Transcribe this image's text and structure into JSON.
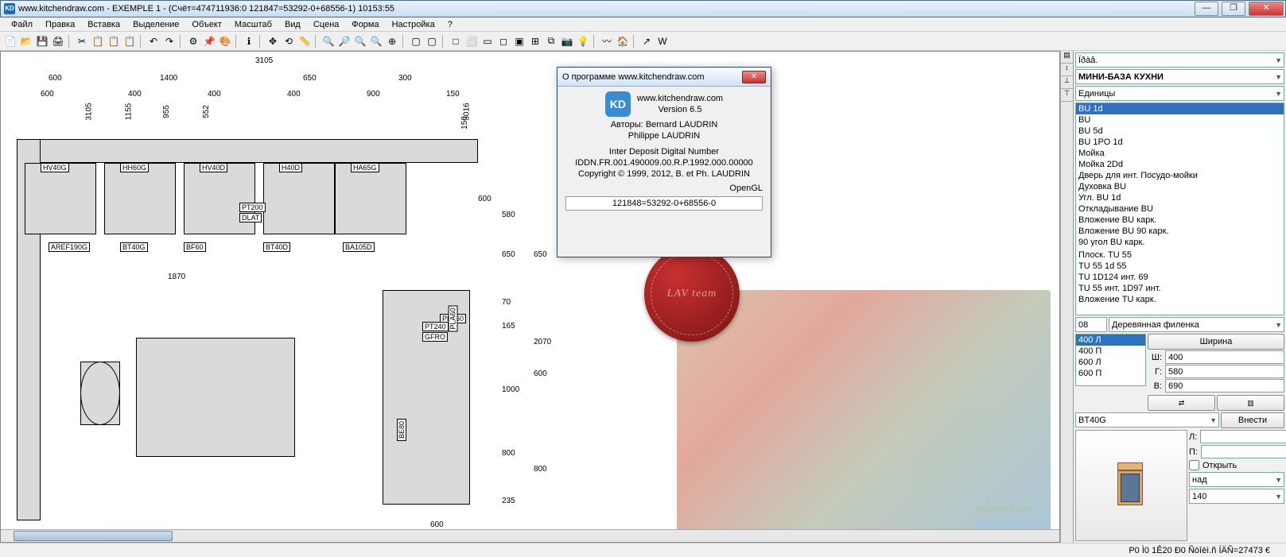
{
  "titlebar": {
    "icon_text": "KD",
    "title": "www.kitchendraw.com - EXEMPLE 1 - (Счёт=474711936:0 121847=53292-0+68556-1) 10153:55"
  },
  "menus": [
    "Файл",
    "Правка",
    "Вставка",
    "Выделение",
    "Объект",
    "Масштаб",
    "Вид",
    "Сцена",
    "Форма",
    "Настройка",
    "?"
  ],
  "toolbar_icons": [
    "📄",
    "📂",
    "💾",
    "🖨",
    "",
    "✂",
    "📋",
    "📋",
    "📋",
    "",
    "↶",
    "↷",
    "",
    "⚙",
    "📌",
    "🎨",
    "",
    "ℹ",
    "",
    "✥",
    "⟲",
    "📏",
    "",
    "🔍",
    "🔎",
    "🔍",
    "🔍",
    "⊕",
    "",
    "▢",
    "▢",
    "",
    "□",
    "⬜",
    "▭",
    "◻",
    "▣",
    "⊞",
    "⧉",
    "📷",
    "💡",
    "",
    "〰",
    "🏠",
    "",
    "↗",
    "W"
  ],
  "right": {
    "idaa": "Ïðàâ.",
    "db": "МИНИ-БАЗА КУХНИ",
    "units": "Единицы",
    "list": [
      "BU  1d",
      "BU",
      "BU 5d",
      "BU 1PO 1d",
      "Мойка",
      "Мойка  2Dd",
      "Дверь для инт. Посудо-мойки",
      "Духовка BU",
      "Угл. BU  1d",
      "Откладывание BU",
      "Вложение BU карк.",
      "Вложение BU 90  карк.",
      "90 угол BU карк.",
      "",
      "Плоск. TU 55",
      "TU 55 1d  55",
      "TU 1D124 инт. 69",
      "TU 55 инт. 1D97 инт.",
      "Вложение TU карк."
    ],
    "list_sel": "BU  1d",
    "front_code": "08",
    "front_label": "Деревянная филенка",
    "sizes": [
      "400 Л",
      "400 П",
      "600 Л",
      "600 П"
    ],
    "size_sel": "400 Л",
    "width_btn": "Ширина",
    "dims": {
      "w_label": "Ш:",
      "w": "400",
      "d_label": "Г:",
      "d": "580",
      "h_label": "В:",
      "h": "690"
    },
    "code": "BT40G",
    "insert_btn": "Внести",
    "side": {
      "l_label": "Л:",
      "r_label": "П:"
    },
    "open_chk": "Открыть",
    "over": "над",
    "depth_last": "140"
  },
  "about": {
    "title": "О программе www.kitchendraw.com",
    "site": "www.kitchendraw.com",
    "ver": "Version 6.5",
    "authors_label": "Авторы:",
    "author1": "Bernard LAUDRIN",
    "author2": "Philippe LAUDRIN",
    "iddn_label": "Inter Deposit Digital Number",
    "iddn": "IDDN.FR.001.490009.00.R.P.1992.000.00000",
    "copy": "Copyright © 1999, 2012, B. et Ph. LAUDRIN",
    "gl": "OpenGL",
    "serial": "121848=53292-0+68556-0"
  },
  "seal": "LAV\nteam",
  "logo": {
    "brand": "Kitchen Draw",
    "ver": "Version 6.5"
  },
  "cad": {
    "top_total": "3105",
    "top_row1": [
      "600",
      "1400",
      "650",
      "300"
    ],
    "top_row2": [
      "600",
      "400",
      "400",
      "400",
      "900",
      "150"
    ],
    "left_row": [
      "3105",
      "1155",
      "955",
      "552"
    ],
    "right_outer": [
      "3016",
      "150"
    ],
    "right_scale": [
      "235",
      "800",
      "1000",
      "165",
      "70",
      "650",
      "580"
    ],
    "right_scale2": [
      "800",
      "600",
      "2070",
      "650"
    ],
    "bottom_dim": "600",
    "mid_dim": "1870",
    "mid_dim2": "600",
    "cabs": [
      "HV40G",
      "HH60G",
      "HV40D",
      "H40D",
      "HA65G",
      "AREF190G",
      "BT40G",
      "BF60",
      "BT40D",
      "BA105D",
      "PT200",
      "DLAT",
      "PLA60",
      "PT240",
      "GFRO",
      "BE80"
    ]
  },
  "status": "P0 Ì0 1Ê20 Ð0 Ñòîèì.ñ ÍÄÑ=27473 €"
}
